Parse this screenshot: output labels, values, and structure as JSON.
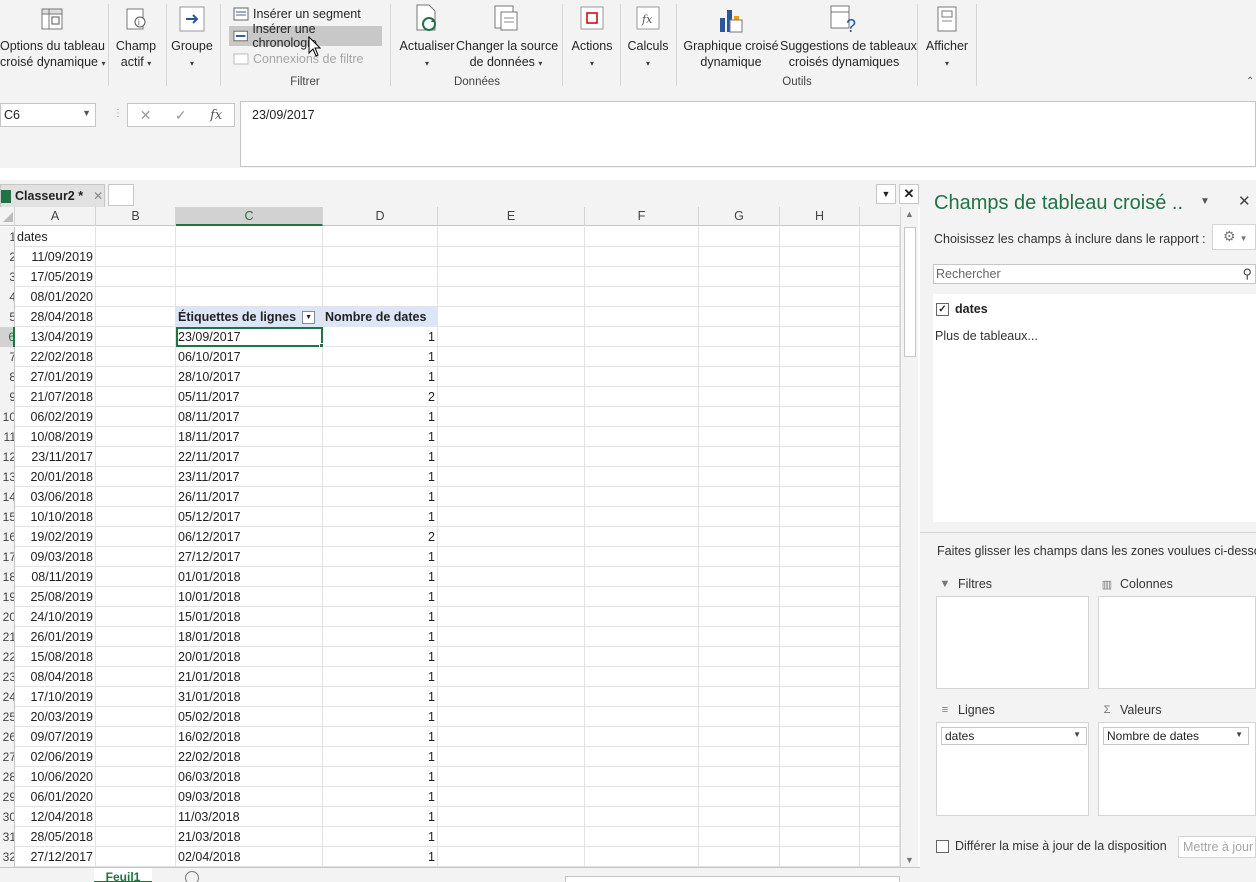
{
  "ribbon": {
    "options": {
      "label1": "Options du tableau",
      "label2": "croisé dynamique"
    },
    "champ_actif": {
      "label1": "Champ",
      "label2": "actif"
    },
    "groupe": {
      "label": "Groupe"
    },
    "filtrer": {
      "inserer_segment": "Insérer un segment",
      "inserer_chronologie": "Insérer une chronologie",
      "connexions_filtre": "Connexions de filtre",
      "group_label": "Filtrer"
    },
    "donnees": {
      "actualiser": "Actualiser",
      "changer1": "Changer la source",
      "changer2": "de données",
      "group_label": "Données"
    },
    "actions": {
      "label": "Actions"
    },
    "calculs": {
      "label": "Calculs"
    },
    "outils": {
      "graphique1": "Graphique croisé",
      "graphique2": "dynamique",
      "suggestions1": "Suggestions de tableaux",
      "suggestions2": "croisés dynamiques",
      "group_label": "Outils"
    },
    "afficher": {
      "label": "Afficher"
    }
  },
  "formula_bar": {
    "name_box": "C6",
    "cancel_glyph": "✕",
    "enter_glyph": "✓",
    "fx_glyph": "fx",
    "formula": "23/09/2017"
  },
  "workbook": {
    "tab_title": "Classeur2 *",
    "close_glyph": "✕"
  },
  "grid": {
    "columns": [
      "A",
      "B",
      "C",
      "D",
      "E",
      "F",
      "G",
      "H"
    ],
    "selected_column": "C",
    "selected_row": 6,
    "header_A": "dates",
    "pivot_header_labels": "Étiquettes de lignes",
    "pivot_header_count": "Nombre de dates",
    "rows": [
      {
        "n": "1",
        "a": "dates",
        "c": "",
        "d": ""
      },
      {
        "n": "2",
        "a": "11/09/2019",
        "c": "",
        "d": ""
      },
      {
        "n": "3",
        "a": "17/05/2019",
        "c": "",
        "d": ""
      },
      {
        "n": "4",
        "a": "08/01/2020",
        "c": "",
        "d": ""
      },
      {
        "n": "5",
        "a": "28/04/2018",
        "c": "Étiquettes de lignes",
        "d": "Nombre de dates"
      },
      {
        "n": "6",
        "a": "13/04/2019",
        "c": "23/09/2017",
        "d": "1"
      },
      {
        "n": "7",
        "a": "22/02/2018",
        "c": "06/10/2017",
        "d": "1"
      },
      {
        "n": "8",
        "a": "27/01/2019",
        "c": "28/10/2017",
        "d": "1"
      },
      {
        "n": "9",
        "a": "21/07/2018",
        "c": "05/11/2017",
        "d": "2"
      },
      {
        "n": "10",
        "a": "06/02/2019",
        "c": "08/11/2017",
        "d": "1"
      },
      {
        "n": "11",
        "a": "10/08/2019",
        "c": "18/11/2017",
        "d": "1"
      },
      {
        "n": "12",
        "a": "23/11/2017",
        "c": "22/11/2017",
        "d": "1"
      },
      {
        "n": "13",
        "a": "20/01/2018",
        "c": "23/11/2017",
        "d": "1"
      },
      {
        "n": "14",
        "a": "03/06/2018",
        "c": "26/11/2017",
        "d": "1"
      },
      {
        "n": "15",
        "a": "10/10/2018",
        "c": "05/12/2017",
        "d": "1"
      },
      {
        "n": "16",
        "a": "19/02/2019",
        "c": "06/12/2017",
        "d": "2"
      },
      {
        "n": "17",
        "a": "09/03/2018",
        "c": "27/12/2017",
        "d": "1"
      },
      {
        "n": "18",
        "a": "08/11/2019",
        "c": "01/01/2018",
        "d": "1"
      },
      {
        "n": "19",
        "a": "25/08/2019",
        "c": "10/01/2018",
        "d": "1"
      },
      {
        "n": "20",
        "a": "24/10/2019",
        "c": "15/01/2018",
        "d": "1"
      },
      {
        "n": "21",
        "a": "26/01/2019",
        "c": "18/01/2018",
        "d": "1"
      },
      {
        "n": "22",
        "a": "15/08/2018",
        "c": "20/01/2018",
        "d": "1"
      },
      {
        "n": "23",
        "a": "08/04/2018",
        "c": "21/01/2018",
        "d": "1"
      },
      {
        "n": "24",
        "a": "17/10/2019",
        "c": "31/01/2018",
        "d": "1"
      },
      {
        "n": "25",
        "a": "20/03/2019",
        "c": "05/02/2018",
        "d": "1"
      },
      {
        "n": "26",
        "a": "09/07/2019",
        "c": "16/02/2018",
        "d": "1"
      },
      {
        "n": "27",
        "a": "02/06/2019",
        "c": "22/02/2018",
        "d": "1"
      },
      {
        "n": "28",
        "a": "10/06/2020",
        "c": "06/03/2018",
        "d": "1"
      },
      {
        "n": "29",
        "a": "06/01/2020",
        "c": "09/03/2018",
        "d": "1"
      },
      {
        "n": "30",
        "a": "12/04/2018",
        "c": "11/03/2018",
        "d": "1"
      },
      {
        "n": "31",
        "a": "28/05/2018",
        "c": "21/03/2018",
        "d": "1"
      },
      {
        "n": "32",
        "a": "27/12/2017",
        "c": "02/04/2018",
        "d": "1"
      }
    ]
  },
  "sheet_tabs": {
    "active": "Feuil1"
  },
  "pane": {
    "title": "Champs de tableau croisé ..",
    "subtitle": "Choisissez les champs à inclure dans le rapport :",
    "search_placeholder": "Rechercher",
    "field_dates": "dates",
    "field_dates_checked": true,
    "more_tables": "Plus de tableaux...",
    "drag_hint": "Faites glisser les champs dans les zones voulues ci-dessous:",
    "filtres": "Filtres",
    "colonnes": "Colonnes",
    "lignes": "Lignes",
    "valeurs": "Valeurs",
    "lignes_item": "dates",
    "valeurs_item": "Nombre de dates",
    "defer": "Différer la mise à jour de la disposition",
    "update": "Mettre à jour"
  },
  "colors": {
    "accent": "#217346",
    "pivot_header_bg": "#dce6f7",
    "ribbon_bg": "#f3f3f3"
  }
}
